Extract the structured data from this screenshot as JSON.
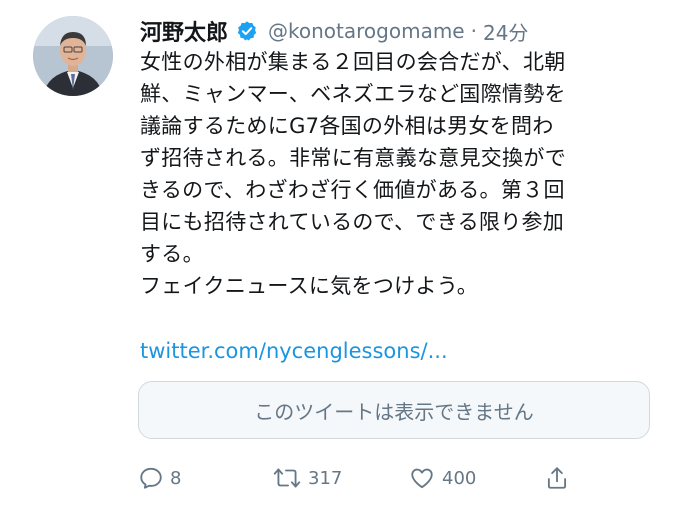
{
  "author": {
    "display_name": "河野太郎",
    "handle": "@konotarogomame",
    "separator": "·",
    "timestamp": "24分",
    "verified": true,
    "avatar_icon": "profile-photo"
  },
  "tweet": {
    "lines": [
      "女性の外相が集まる２回目の会合だが、北朝",
      "鮮、ミャンマー、ベネズエラなど国際情勢を",
      "議論するためにG7各国の外相は男女を問わ",
      "ず招待される。非常に有意義な意見交換がで",
      "きるので、わざわざ行く価値がある。第３回",
      "目にも招待されているので、できる限り参加",
      "する。",
      "フェイクニュースに気をつけよう。"
    ],
    "link": "twitter.com/nycenglessons/..."
  },
  "quoted": {
    "unavailable_text": "このツイートは表示できません"
  },
  "actions": {
    "reply_count": "8",
    "retweet_count": "317",
    "like_count": "400"
  },
  "colors": {
    "text": "#14171a",
    "secondary": "#657786",
    "link": "#1b95e0",
    "verified": "#1da1f2",
    "quote_bg": "#f5f8fa",
    "quote_border": "#cfd9de"
  }
}
